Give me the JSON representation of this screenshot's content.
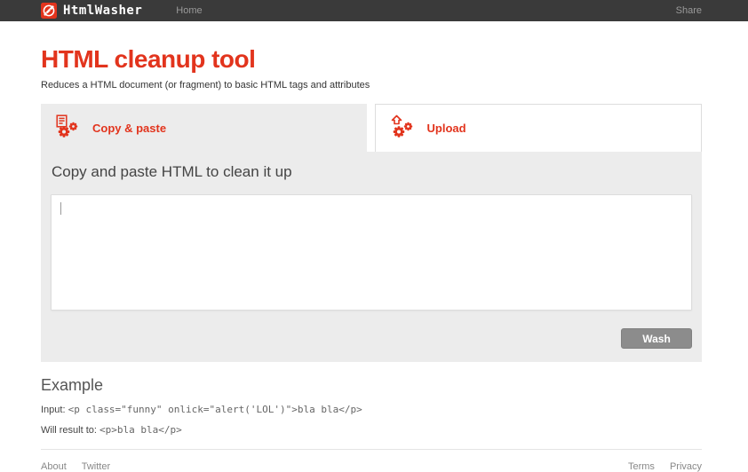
{
  "navbar": {
    "brand": "HtmlWasher",
    "home_label": "Home",
    "share_label": "Share"
  },
  "header": {
    "title": "HTML cleanup tool",
    "subtitle": "Reduces a HTML document (or fragment) to basic HTML tags and attributes"
  },
  "tabs": [
    {
      "label": "Copy & paste",
      "icon": "document-gears-icon",
      "active": true
    },
    {
      "label": "Upload",
      "icon": "upload-gears-icon",
      "active": false
    }
  ],
  "panel": {
    "heading": "Copy and paste HTML to clean it up",
    "textarea_value": "",
    "wash_button_label": "Wash"
  },
  "example": {
    "heading": "Example",
    "input_label": "Input: ",
    "input_code": "<p class=\"funny\" onlick=\"alert('LOL')\">bla bla</p>",
    "result_label": "Will result to: ",
    "result_code": "<p>bla bla</p>"
  },
  "footer": {
    "left_links": [
      "About",
      "Twitter"
    ],
    "right_links": [
      "Terms",
      "Privacy"
    ]
  },
  "colors": {
    "accent_red": "#e2341d",
    "navbar_bg": "#3a3a3a",
    "panel_bg": "#ececec",
    "wash_button_bg": "#8c8c8c"
  }
}
